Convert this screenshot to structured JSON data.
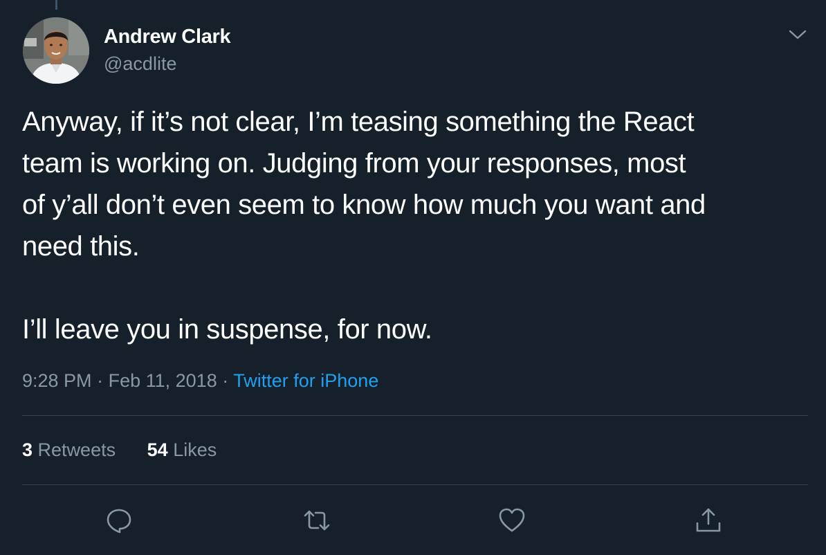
{
  "author": {
    "name": "Andrew Clark",
    "handle": "@acdlite"
  },
  "tweet": {
    "lines": [
      "Anyway, if it’s not clear, I’m teasing something the React",
      "team is working on. Judging from your responses, most",
      "of y’all don’t even seem to know how much you want and",
      "need this.",
      "I’ll leave you in suspense, for now."
    ]
  },
  "meta": {
    "time": "9:28 PM",
    "separator": "·",
    "date": "Feb 11, 2018",
    "source": "Twitter for iPhone"
  },
  "stats": {
    "retweets_count": "3",
    "retweets_label": "Retweets",
    "likes_count": "54",
    "likes_label": "Likes"
  },
  "icons": {
    "more": "chevron-down-icon",
    "reply": "reply-icon",
    "retweet": "retweet-icon",
    "like": "heart-icon",
    "share": "share-icon"
  },
  "colors": {
    "background": "#15202b",
    "secondary_text": "#8899a6",
    "link": "#1da1f2",
    "divider": "#38444d"
  }
}
